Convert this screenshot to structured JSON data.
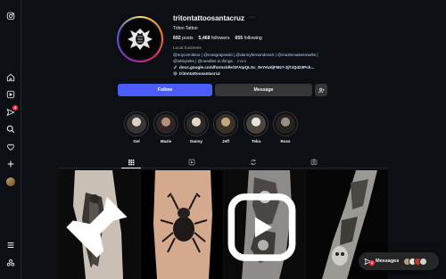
{
  "sidebar": {
    "notifications_badge": "4"
  },
  "profile": {
    "username": "tritontattoosantacruz",
    "more_label": "···",
    "full_name": "Triton Tattoo",
    "stats": {
      "posts_count": "692",
      "posts_label": "posts",
      "followers_count": "5,468",
      "followers_label": "followers",
      "following_count": "655",
      "following_label": "following"
    },
    "category": "Local business",
    "bio_line1": "@noycemiktoo | @rossgrajewski | @dannyfernandezart | @mazlemakesmarks |",
    "bio_line2_handle": "@inkbyteks | @needles.in.things",
    "bio_line2_ellipsis": "... ",
    "bio_line2_more": "more",
    "bio_link": "docs.google.com/forms/d/e/1FAIpQLSc_9vYeUdjFMz7-3jTzQ423Pch...",
    "bio_threads": "tritontattoosantacruz"
  },
  "actions": {
    "follow_label": "Follow",
    "message_label": "Message"
  },
  "highlights": [
    {
      "label": "Gel",
      "color": "#b9b2a8"
    },
    {
      "label": "Mazie",
      "color": "#8a6f63"
    },
    {
      "label": "Danny",
      "color": "#c9b9a9"
    },
    {
      "label": "Jeff",
      "color": "#a58f74"
    },
    {
      "label": "Teka",
      "color": "#d8d2cb"
    },
    {
      "label": "Ross",
      "color": "#7c736d"
    }
  ],
  "tabs": [
    "posts-tab",
    "reels-tab",
    "reposts-tab",
    "tagged-tab"
  ],
  "messages": {
    "label": "Messages",
    "badge": "4"
  },
  "colors": {
    "background": "#0c1014",
    "follow_button": "#4a5df9",
    "secondary_button": "#363636",
    "notification_red": "#ff3040"
  }
}
